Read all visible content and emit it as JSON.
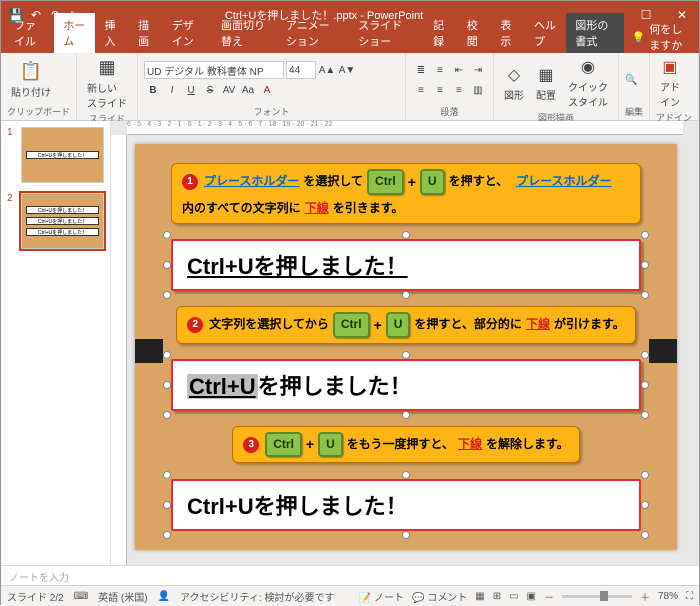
{
  "app": {
    "title": "Ctrl+Uを押しました！.pptx - PowerPoint"
  },
  "qat": {
    "save": "💾",
    "undo": "↶",
    "redo": "↷",
    "start": "▷"
  },
  "winctl": {
    "ribbonopt": "▭",
    "min": "—",
    "max": "☐",
    "close": "✕"
  },
  "tabs": {
    "file": "ファイル",
    "home": "ホーム",
    "insert": "挿入",
    "draw": "描画",
    "design": "デザイン",
    "transitions": "画面切り替え",
    "animations": "アニメーション",
    "slideshow": "スライド ショー",
    "record": "記録",
    "review": "校閲",
    "view": "表示",
    "help": "ヘルプ",
    "format": "図形の書式",
    "tell_icon": "💡",
    "tell": "何をしますか"
  },
  "ribbon": {
    "clipboard": {
      "paste": "貼り付け",
      "label": "クリップボード"
    },
    "slides": {
      "new": "新しい\nスライド",
      "label": "スライド"
    },
    "font": {
      "name": "UD デジタル 教科書体 NP",
      "size": "44",
      "b": "B",
      "i": "I",
      "u": "U",
      "s": "S",
      "av": "AV",
      "aa": "Aa",
      "a_up": "A▲",
      "a_dn": "A▼",
      "label": "フォント"
    },
    "drawing": {
      "shapes": "図形",
      "arrange": "配置",
      "quick": "クイック\nスタイル",
      "label": "図形描画"
    },
    "editing": {
      "label": "編集"
    },
    "addin": {
      "btn": "アド\nイン",
      "label": "アドイン"
    }
  },
  "ruler": {
    "marks": "6 · 5 · 4 · 3 · 2 · 1 · 0 · 1 · 2 · 3 · 4 · 5 · 6 · 7 · 18 · 19 · 20 · 21 · 22"
  },
  "thumbs": [
    {
      "n": "1",
      "lines": [
        "Ctrl+Uを押しました！"
      ]
    },
    {
      "n": "2",
      "lines": [
        "Ctrl+Uを押しました！",
        "Ctrl+Uを押しました！",
        "Ctrl+Uを押しました！"
      ]
    }
  ],
  "callouts": {
    "c1": {
      "num": "1",
      "link": "プレースホルダー",
      "t1": "を選択して",
      "k1": "Ctrl",
      "k2": "U",
      "t2": "を押すと、",
      "link2": "プレースホルダー",
      "t3": "内のすべての文字列に",
      "red": "下線",
      "t4": "を引きます。"
    },
    "c2": {
      "num": "2",
      "t1": "文字列を選択してから",
      "k1": "Ctrl",
      "k2": "U",
      "t2": "を押すと、部分的に",
      "red": "下線",
      "t3": "が引けます。"
    },
    "c3": {
      "num": "3",
      "k1": "Ctrl",
      "k2": "U",
      "t1": "をもう一度押すと、",
      "red": "下線",
      "t2": "を解除します。"
    }
  },
  "placeholders": {
    "p1": "Ctrl+Uを押しました！",
    "p2_sel": "Ctrl+U",
    "p2_rest": "を押しました！",
    "p3": "Ctrl+Uを押しました！"
  },
  "notes": {
    "placeholder": "ノートを入力"
  },
  "status": {
    "slide": "スライド 2/2",
    "lang_icon": "⌨",
    "lang": "英語 (米国)",
    "acc_icon": "👤",
    "acc": "アクセシビリティ: 検討が必要です",
    "notes_btn": "ノート",
    "comments_btn": "コメント",
    "zoom_pct": "78%",
    "minus": "－",
    "plus": "＋",
    "fit": "⛶"
  }
}
